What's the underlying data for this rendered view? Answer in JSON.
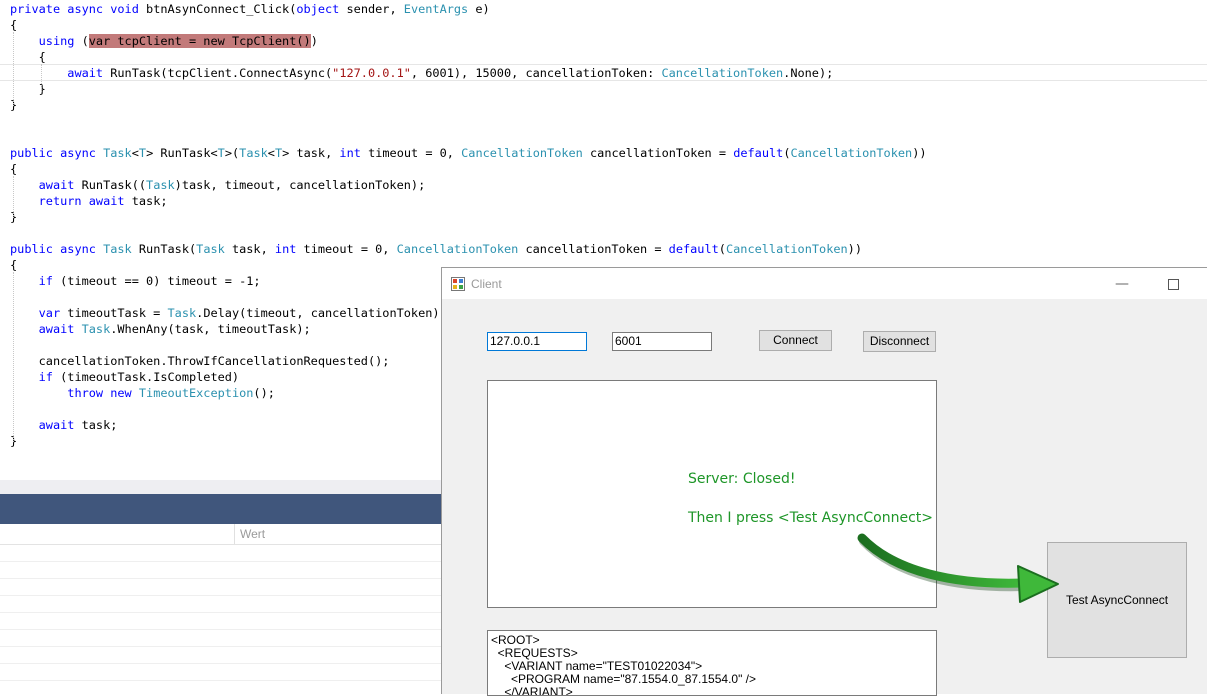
{
  "editor": {
    "lines": [
      [
        [
          "kw",
          "private "
        ],
        [
          "kw",
          "async "
        ],
        [
          "kw",
          "void "
        ],
        [
          "",
          "btnAsynConnect_Click("
        ],
        [
          "kw",
          "object "
        ],
        [
          "",
          "sender, "
        ],
        [
          "typ",
          "EventArgs "
        ],
        [
          "",
          "e)"
        ]
      ],
      [
        [
          "",
          "{"
        ]
      ],
      [
        [
          "",
          "    "
        ],
        [
          "kw",
          "using "
        ],
        [
          "",
          "("
        ],
        [
          "hl",
          "var tcpClient = new TcpClient()"
        ],
        [
          "",
          ")"
        ]
      ],
      [
        [
          "",
          "    {"
        ]
      ],
      [
        [
          "",
          "        "
        ],
        [
          "kw",
          "await "
        ],
        [
          "",
          "RunTask(tcpClient.ConnectAsync("
        ],
        [
          "str",
          "\"127.0.0.1\""
        ],
        [
          "",
          ", 6001), 15000, cancellationToken: "
        ],
        [
          "typ",
          "CancellationToken"
        ],
        [
          "",
          ".None);"
        ]
      ],
      [
        [
          "",
          "    }"
        ]
      ],
      [
        [
          "",
          "}"
        ]
      ],
      [],
      [],
      [
        [
          "kw",
          "public "
        ],
        [
          "kw",
          "async "
        ],
        [
          "typ",
          "Task"
        ],
        [
          "",
          "<"
        ],
        [
          "typ",
          "T"
        ],
        [
          "",
          "> RunTask<"
        ],
        [
          "typ",
          "T"
        ],
        [
          "",
          ">("
        ],
        [
          "typ",
          "Task"
        ],
        [
          "",
          "<"
        ],
        [
          "typ",
          "T"
        ],
        [
          "",
          "> task, "
        ],
        [
          "kw",
          "int "
        ],
        [
          "",
          "timeout = 0, "
        ],
        [
          "typ",
          "CancellationToken "
        ],
        [
          "",
          "cancellationToken = "
        ],
        [
          "kw",
          "default"
        ],
        [
          "",
          "("
        ],
        [
          "typ",
          "CancellationToken"
        ],
        [
          "",
          "))"
        ]
      ],
      [
        [
          "",
          "{"
        ]
      ],
      [
        [
          "",
          "    "
        ],
        [
          "kw",
          "await "
        ],
        [
          "",
          "RunTask(("
        ],
        [
          "typ",
          "Task"
        ],
        [
          "",
          ")task, timeout, cancellationToken);"
        ]
      ],
      [
        [
          "",
          "    "
        ],
        [
          "kw",
          "return "
        ],
        [
          "kw",
          "await "
        ],
        [
          "",
          "task;"
        ]
      ],
      [
        [
          "",
          "}"
        ]
      ],
      [],
      [
        [
          "kw",
          "public "
        ],
        [
          "kw",
          "async "
        ],
        [
          "typ",
          "Task "
        ],
        [
          "",
          "RunTask("
        ],
        [
          "typ",
          "Task "
        ],
        [
          "",
          "task, "
        ],
        [
          "kw",
          "int "
        ],
        [
          "",
          "timeout = 0, "
        ],
        [
          "typ",
          "CancellationToken "
        ],
        [
          "",
          "cancellationToken = "
        ],
        [
          "kw",
          "default"
        ],
        [
          "",
          "("
        ],
        [
          "typ",
          "CancellationToken"
        ],
        [
          "",
          "))"
        ]
      ],
      [
        [
          "",
          "{"
        ]
      ],
      [
        [
          "",
          "    "
        ],
        [
          "kw",
          "if "
        ],
        [
          "",
          "(timeout == 0) timeout = -1;"
        ]
      ],
      [],
      [
        [
          "",
          "    "
        ],
        [
          "kw",
          "var "
        ],
        [
          "",
          "timeoutTask = "
        ],
        [
          "typ",
          "Task"
        ],
        [
          "",
          ".Delay(timeout, cancellationToken);"
        ]
      ],
      [
        [
          "",
          "    "
        ],
        [
          "kw",
          "await "
        ],
        [
          "typ",
          "Task"
        ],
        [
          "",
          ".WhenAny(task, timeoutTask);"
        ]
      ],
      [],
      [
        [
          "",
          "    cancellationToken.ThrowIfCancellationRequested();"
        ]
      ],
      [
        [
          "",
          "    "
        ],
        [
          "kw",
          "if "
        ],
        [
          "",
          "(timeoutTask.IsCompleted)"
        ]
      ],
      [
        [
          "",
          "        "
        ],
        [
          "kw",
          "throw "
        ],
        [
          "kw",
          "new "
        ],
        [
          "typ",
          "TimeoutException"
        ],
        [
          "",
          "();"
        ]
      ],
      [],
      [
        [
          "",
          "    "
        ],
        [
          "kw",
          "await "
        ],
        [
          "",
          "task;"
        ]
      ],
      [
        [
          "",
          "}"
        ]
      ]
    ]
  },
  "bottom_panel": {
    "column_header": "Wert"
  },
  "client_window": {
    "title": "Client",
    "minimize_glyph": "—",
    "ip_value": "127.0.0.1",
    "port_value": "6001",
    "connect_label": "Connect",
    "disconnect_label": "Disconnect",
    "messages": [
      "Server: Closed!",
      "Then I press <Test AsyncConnect>"
    ],
    "test_button_label": "Test AsyncConnect",
    "xml_lines": [
      "<ROOT>",
      "  <REQUESTS>",
      "    <VARIANT name=\"TEST01022034\">",
      "      <PROGRAM name=\"87.1554.0_87.1554.0\" />",
      "    </VARIANT>"
    ]
  },
  "colors": {
    "keyword": "#0000ff",
    "type": "#2b91af",
    "string": "#a31515",
    "annotation_green": "#1e9628",
    "panel_bar": "#40567c"
  },
  "icons": [
    "app-icon",
    "minimize-icon",
    "maximize-icon",
    "arrow-annotation"
  ]
}
